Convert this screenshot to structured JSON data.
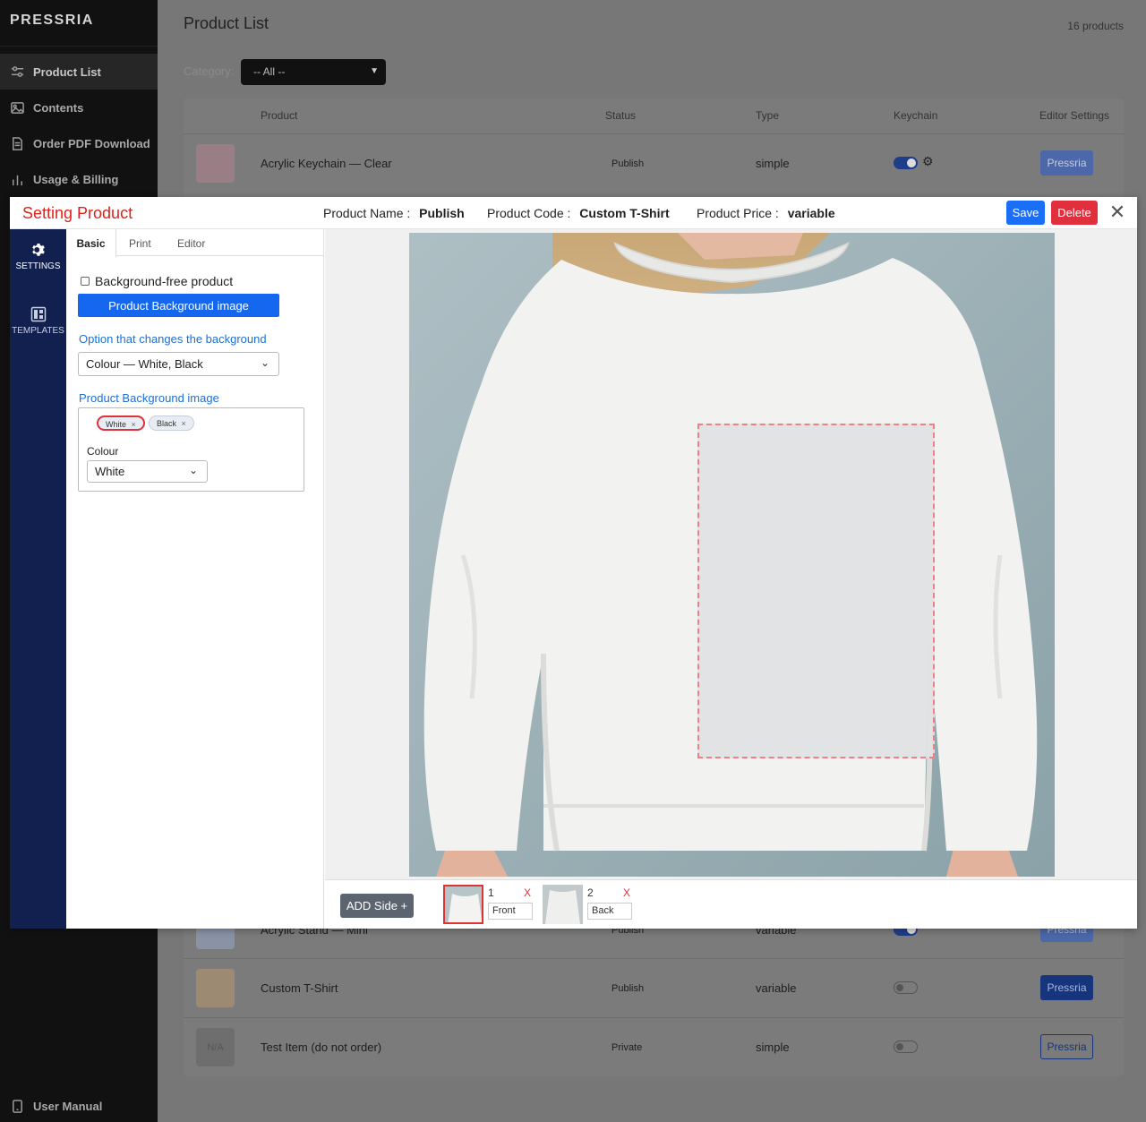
{
  "app": {
    "brand": "PRESSRIA",
    "nav": [
      {
        "label": "Product List",
        "icon": "sliders-icon"
      },
      {
        "label": "Contents",
        "icon": "image-icon"
      },
      {
        "label": "Order PDF Download",
        "icon": "document-icon"
      },
      {
        "label": "Usage & Billing",
        "icon": "bar-chart-icon"
      }
    ],
    "nav_bottom": {
      "label": "User Manual",
      "icon": "tablet-icon"
    }
  },
  "page": {
    "title": "Product List",
    "count": "16 products",
    "filter_label": "Category:",
    "filter_value": "-- All --",
    "columns": [
      "Product",
      "Status",
      "Type",
      "Keychain",
      "Editor Settings"
    ],
    "rows": [
      {
        "thumb": "",
        "name": "Acrylic Keychain — Clear",
        "status": "Publish",
        "type": "simple",
        "keychain": true,
        "show_gear": true,
        "button": "Pressria"
      },
      {
        "thumb": "",
        "name": "Acrylic Stand — Mini",
        "status": "Publish",
        "type": "variable",
        "keychain": true,
        "show_gear": true,
        "button": "Pressria"
      },
      {
        "thumb": "",
        "name": "Custom T-Shirt",
        "status": "Publish",
        "type": "variable",
        "keychain": false,
        "show_gear": false,
        "button": "Pressria"
      },
      {
        "thumb": "N/A",
        "name": "Test Item (do not order)",
        "status": "Private",
        "type": "simple",
        "keychain": false,
        "show_gear": false,
        "button": "Pressria"
      }
    ]
  },
  "modal": {
    "title": "Setting Product",
    "name_label": "Product Name :",
    "name_value": "Publish",
    "code_label": "Product Code :",
    "code_value": "Custom T-Shirt",
    "price_label": "Product Price :",
    "price_value": "variable",
    "save": "Save",
    "delete": "Delete",
    "rail": [
      {
        "label": "SETTINGS",
        "icon": "gear-icon"
      },
      {
        "label": "TEMPLATES",
        "icon": "templates-icon"
      }
    ],
    "tabs": [
      "Basic",
      "Print",
      "Editor"
    ],
    "bg_free_label": "Background-free product",
    "bg_button": "Product Background image",
    "option_label": "Option that changes the background",
    "option_value": "Colour — White, Black",
    "bg_image_label": "Product Background image",
    "chips": [
      "White",
      "Black"
    ],
    "colour_label": "Colour",
    "colour_value": "White",
    "add_side": "ADD Side +",
    "sides": [
      {
        "num": "1",
        "name": "Front"
      },
      {
        "num": "2",
        "name": "Back"
      }
    ]
  }
}
